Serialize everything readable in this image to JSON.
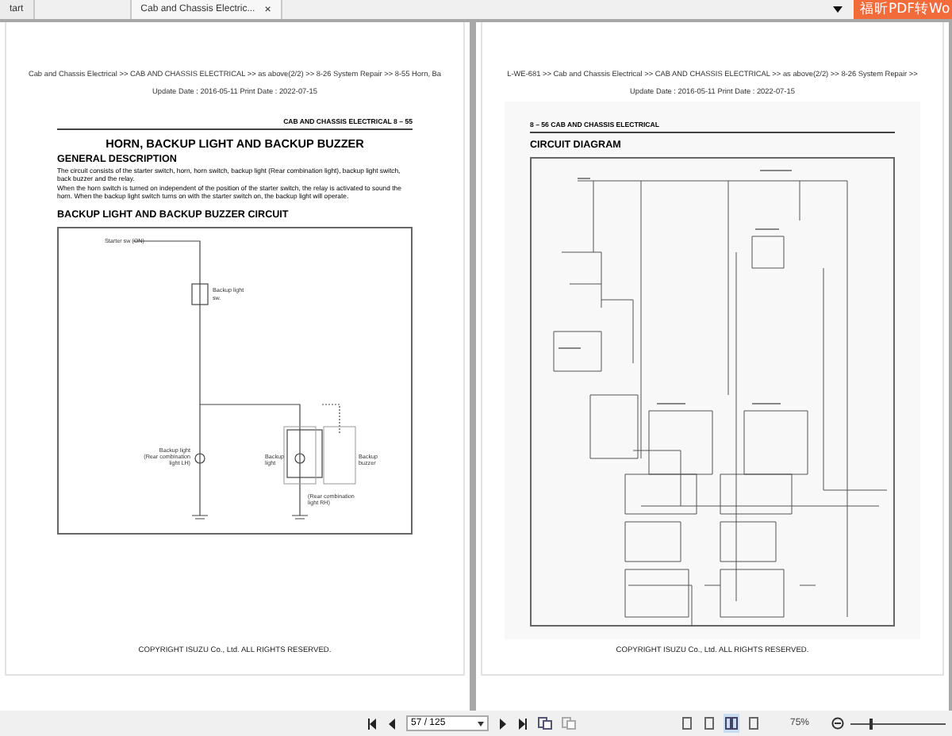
{
  "tabs": [
    {
      "label": "tart",
      "selected": false
    },
    {
      "label": "Cab and Chassis Electric...",
      "selected": true,
      "close": "×"
    }
  ],
  "promo_button": {
    "label": "福昕PDF转Wo"
  },
  "left_page": {
    "breadcrumb": "Cab and Chassis Electrical >> CAB AND CHASSIS ELECTRICAL >> as above(2/2) >> 8-26 System Repair >> 8-55 Horn, Ba",
    "dates": "Update Date : 2016-05-11   Print Date : 2022-07-15",
    "running_header": "CAB AND CHASSIS ELECTRICAL  8 – 55",
    "title": "HORN, BACKUP LIGHT AND BACKUP BUZZER",
    "sections": [
      {
        "heading": "GENERAL DESCRIPTION",
        "paragraphs": [
          "The circuit consists of the starter switch, horn, horn switch, backup light (Rear combination light), backup light switch, back buzzer and the relay.",
          "When the horn switch is turned on independent of the position of the starter switch, the relay is activated to sound the horn.  When the backup light switch turns on with the starter switch on, the backup light will operate."
        ]
      },
      {
        "heading": "BACKUP LIGHT AND BACKUP BUZZER CIRCUIT"
      }
    ],
    "diagram_labels": [
      "Starter sw (ON)",
      "Backup light",
      "sw.",
      "Backup light",
      "(Rear combination",
      "light LH)",
      "Backup",
      "light",
      "Backup",
      "buzzer",
      "(Rear combination",
      "light RH)"
    ],
    "copyright": "COPYRIGHT ISUZU Co., Ltd. ALL RIGHTS RESERVED."
  },
  "right_page": {
    "breadcrumb": "L-WE-681 >> Cab and Chassis Electrical >> CAB AND CHASSIS ELECTRICAL >> as above(2/2) >> 8-26 System Repair >>",
    "dates": "Update Date : 2016-05-11   Print Date : 2022-07-15",
    "running_header": "8 – 56  CAB AND CHASSIS ELECTRICAL",
    "heading": "CIRCUIT DIAGRAM",
    "copyright": "COPYRIGHT ISUZU Co., Ltd. ALL RIGHTS RESERVED."
  },
  "toolbar": {
    "page_field": "57 / 125",
    "view_modes": [
      {
        "selected": false
      },
      {
        "selected": false
      },
      {
        "selected": true
      },
      {
        "selected": false
      }
    ],
    "zoom": "75%",
    "zoom_slider": {
      "level": 0.2
    }
  }
}
